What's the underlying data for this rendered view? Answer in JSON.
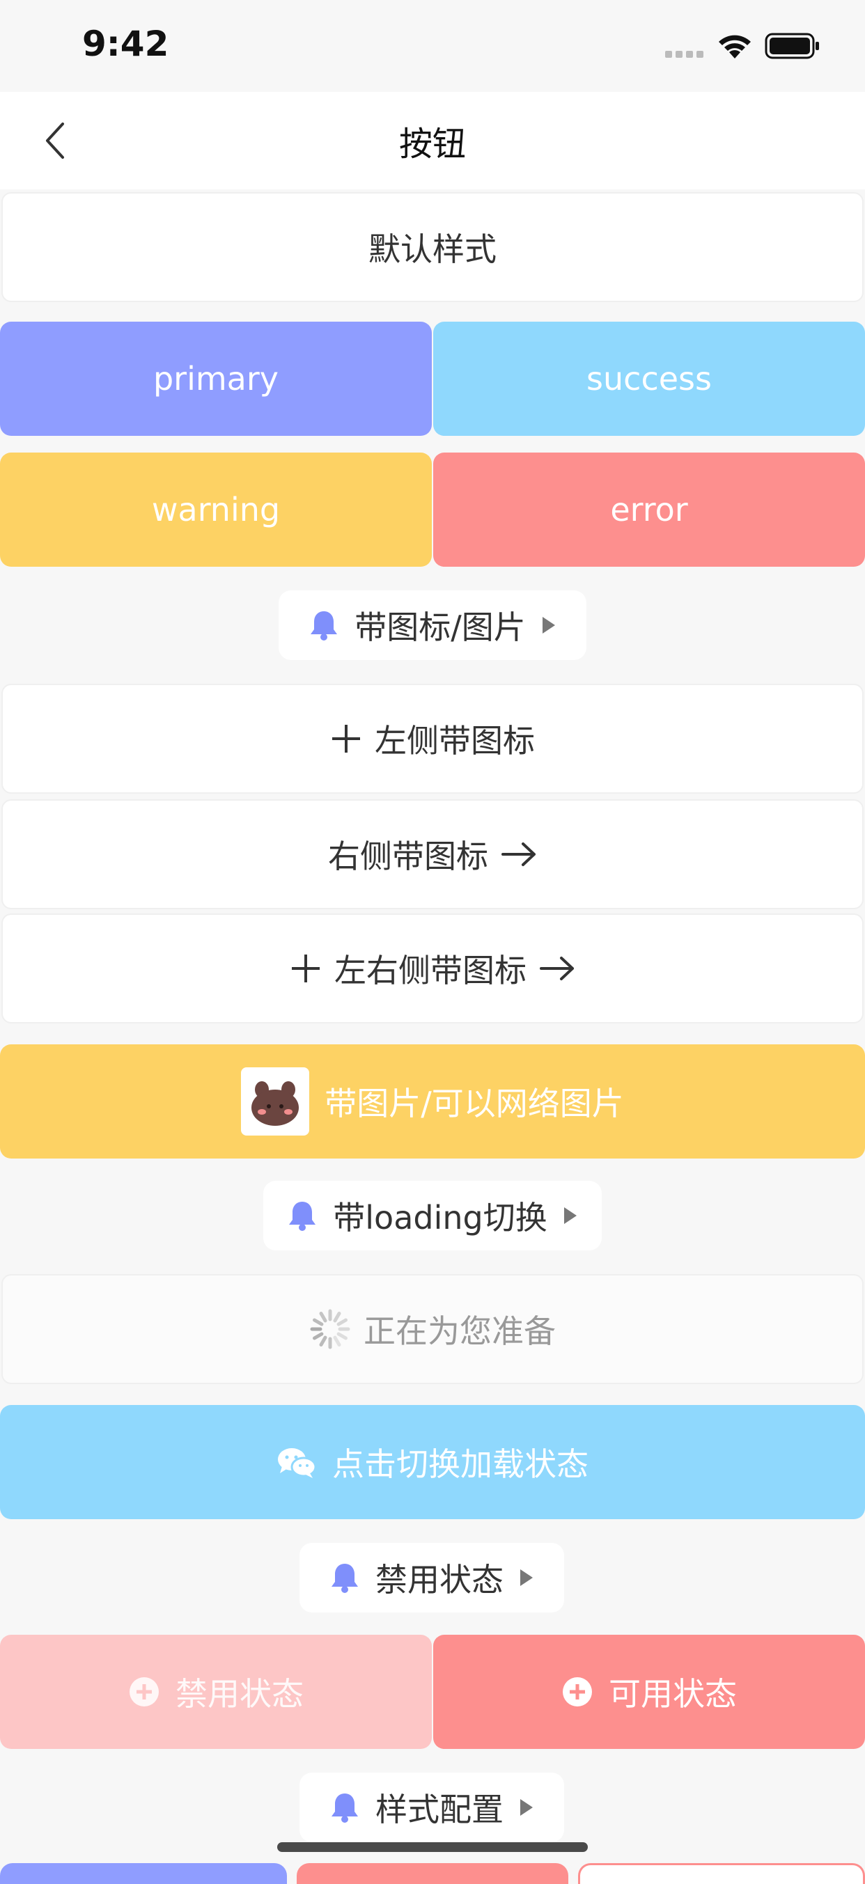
{
  "status": {
    "time": "9:42"
  },
  "nav": {
    "title": "按钮"
  },
  "buttons": {
    "default": "默认样式",
    "primary": "primary",
    "success": "success",
    "warning": "warning",
    "error": "error",
    "left_icon": "左侧带图标",
    "right_icon": "右侧带图标",
    "both_icon": "左右侧带图标",
    "image": "带图片/可以网络图片",
    "loading_text": "正在为您准备",
    "toggle_loading": "点击切换加载状态",
    "disabled": "禁用状态",
    "enabled": "可用状态"
  },
  "sections": {
    "icon_image": "带图标/图片",
    "loading": "带loading切换",
    "disabled": "禁用状态",
    "style_config": "样式配置"
  },
  "colors": {
    "primary": "#8f9dff",
    "success": "#8fd8fd",
    "warning": "#fdd264",
    "error": "#fd8f8e",
    "error_disabled": "#fdc6c6",
    "accent_icon": "#7f8ffb"
  }
}
